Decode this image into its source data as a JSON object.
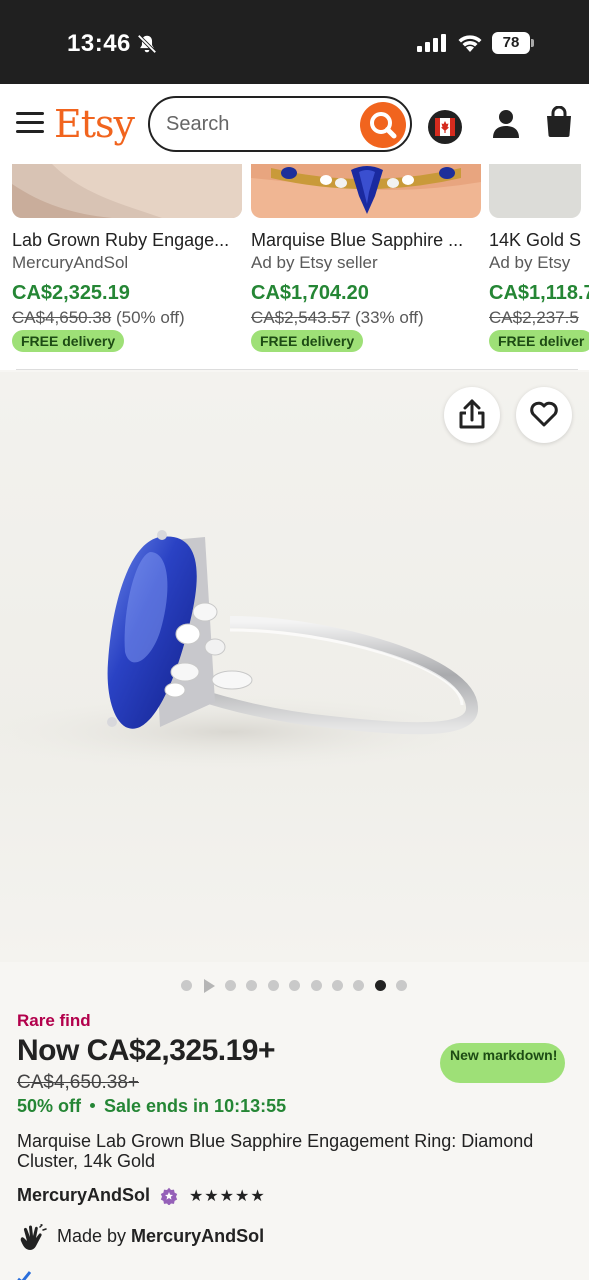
{
  "status_bar": {
    "time": "13:46",
    "battery": "78"
  },
  "header": {
    "logo": "Etsy",
    "search_placeholder": "Search",
    "icons": [
      "menu-icon",
      "search-icon",
      "canada-flag-icon",
      "user-icon",
      "shopping-bag-icon"
    ]
  },
  "recommendations": [
    {
      "title": "Lab Grown Ruby Engage...",
      "seller": "MercuryAndSol",
      "price": "CA$2,325.19",
      "original_price": "CA$4,650.38",
      "discount": "(50% off)",
      "badge": "FREE delivery"
    },
    {
      "title": "Marquise Blue Sapphire ...",
      "seller": "Ad by Etsy seller",
      "price": "CA$1,704.20",
      "original_price": "CA$2,543.57",
      "discount": "(33% off)",
      "badge": "FREE delivery"
    },
    {
      "title": "14K Gold S",
      "seller": "Ad by Etsy",
      "price": "CA$1,118.7",
      "original_price": "CA$2,237.5",
      "discount": "",
      "badge": "FREE deliver"
    }
  ],
  "gallery": {
    "total_slides": 11,
    "active_index": 9,
    "has_video": true
  },
  "listing": {
    "rare_find": "Rare find",
    "now_price": "Now CA$2,325.19+",
    "badge": "New markdown!",
    "original_price": "CA$4,650.38+",
    "discount": "50% off",
    "sale_ends": "Sale ends in 10:13:55",
    "title": "Marquise Lab Grown Blue Sapphire Engagement Ring: Diamond Cluster, 14k Gold",
    "shop_name": "MercuryAndSol",
    "rating_stars": "★★★★★",
    "made_by_prefix": "Made by ",
    "made_by_shop": "MercuryAndSol"
  },
  "colors": {
    "brand": "#f1641e",
    "sale_green": "#258635",
    "badge_green": "#9ee077",
    "rare_red": "#b2004b",
    "status_bar": "#202020"
  }
}
